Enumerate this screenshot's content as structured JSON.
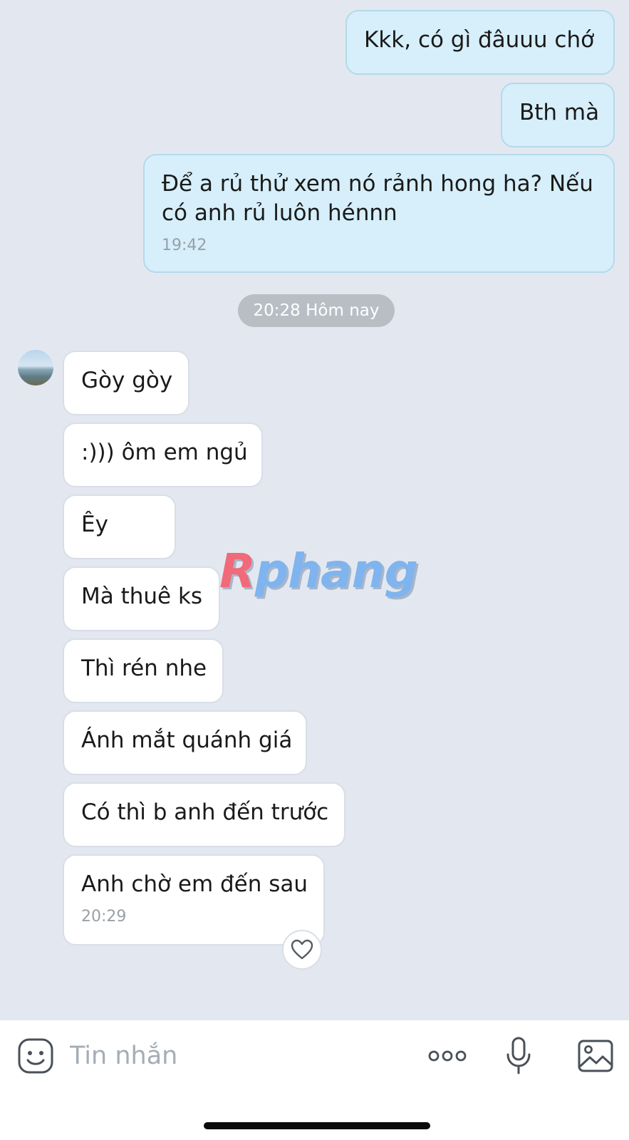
{
  "messages_sent": [
    {
      "text": "Kkk, có gì đâuuu chớ"
    },
    {
      "text": "Bth mà"
    },
    {
      "text": "Để a rủ thử xem nó rảnh hong ha? Nếu có anh rủ luôn hénnn",
      "time": "19:42"
    }
  ],
  "date_separator": "20:28 Hôm nay",
  "messages_received": [
    {
      "text": "Gòy gòy"
    },
    {
      "text": ":))) ôm em ngủ"
    },
    {
      "text": "Êy"
    },
    {
      "text": "Mà thuê ks"
    },
    {
      "text": "Thì rén nhe"
    },
    {
      "text": "Ánh mắt quánh giá"
    },
    {
      "text": "Có thì b anh đến trước"
    },
    {
      "text": "Anh chờ em đến sau",
      "time": "20:29"
    }
  ],
  "watermark": {
    "first": "R",
    "rest": "phang"
  },
  "composer": {
    "placeholder": "Tin nhắn"
  },
  "icons": {
    "emoji": "emoji-smile-icon",
    "more": "more-dots-icon",
    "mic": "microphone-icon",
    "image": "image-icon",
    "react": "heart-icon"
  },
  "colors": {
    "background": "#e3e8f0",
    "sent_bubble": "#d6effa",
    "received_bubble": "#ffffff",
    "date_chip": "#b9bec4"
  }
}
